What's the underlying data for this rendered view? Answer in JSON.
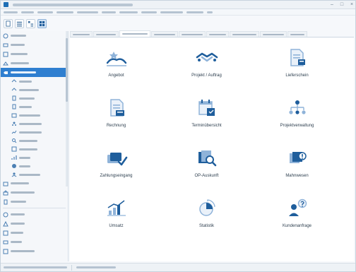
{
  "colors": {
    "accent": "#2f7fd0",
    "icon_blue": "#1f5e9c",
    "icon_light": "#8fb3d9"
  },
  "content": {
    "tiles": [
      {
        "caption": "Angebot",
        "icon": "handshake-offer-icon"
      },
      {
        "caption": "Projekt / Auftrag",
        "icon": "handshake-project-icon"
      },
      {
        "caption": "Lieferschein",
        "icon": "delivery-note-icon"
      },
      {
        "caption": "Rechnung",
        "icon": "invoice-icon"
      },
      {
        "caption": "Terminübersicht",
        "icon": "calendar-icon"
      },
      {
        "caption": "Projektverwaltung",
        "icon": "org-chart-icon"
      },
      {
        "caption": "Zahlungseingang",
        "icon": "payment-check-icon"
      },
      {
        "caption": "OP-Auskunft",
        "icon": "search-documents-icon"
      },
      {
        "caption": "Mahnwesen",
        "icon": "reminder-alert-icon"
      },
      {
        "caption": "Umsatz",
        "icon": "revenue-chart-icon"
      },
      {
        "caption": "Statistik",
        "icon": "pie-chart-icon"
      },
      {
        "caption": "Kundenanfrage",
        "icon": "customer-inquiry-icon"
      }
    ]
  }
}
